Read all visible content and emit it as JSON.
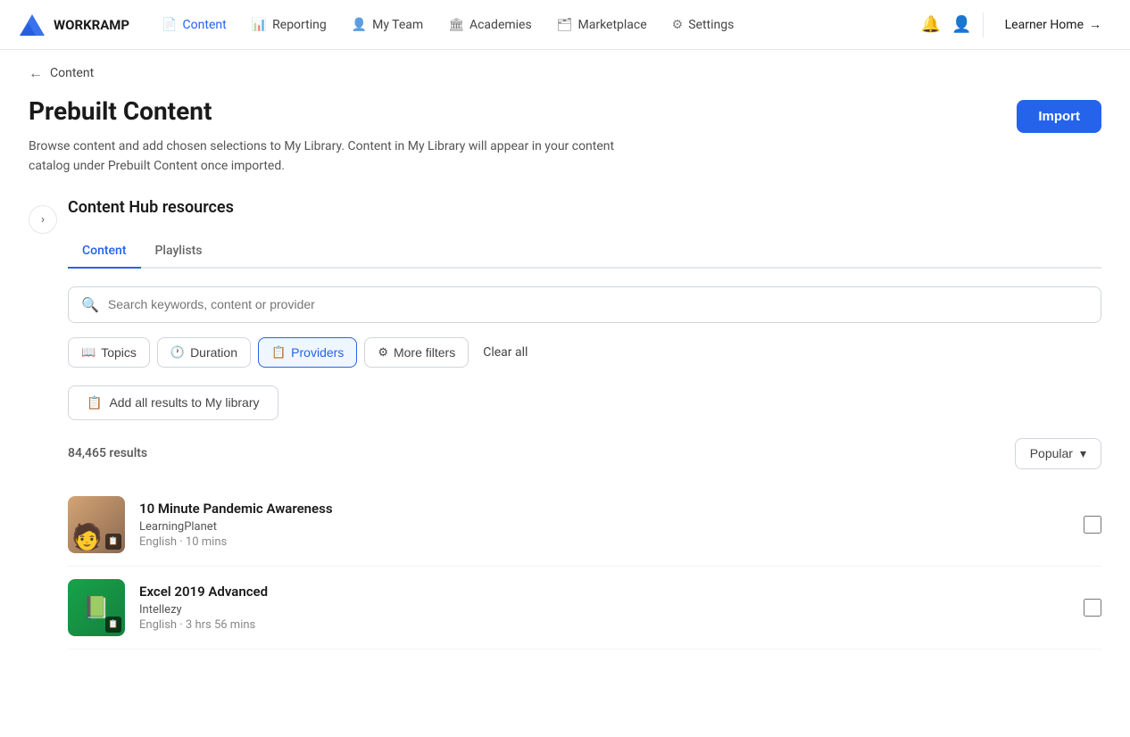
{
  "app": {
    "name": "WORKRAMP"
  },
  "nav": {
    "items": [
      {
        "id": "content",
        "label": "Content",
        "icon": "📄",
        "active": true
      },
      {
        "id": "reporting",
        "label": "Reporting",
        "icon": "📊"
      },
      {
        "id": "my-team",
        "label": "My Team",
        "icon": "👤"
      },
      {
        "id": "academies",
        "label": "Academies",
        "icon": "🏛"
      },
      {
        "id": "marketplace",
        "label": "Marketplace",
        "icon": "🗂"
      },
      {
        "id": "settings",
        "label": "Settings",
        "icon": "⚙"
      }
    ],
    "learner_home": "Learner Home"
  },
  "breadcrumb": {
    "back_label": "←",
    "link_label": "Content"
  },
  "page": {
    "title": "Prebuilt Content",
    "description": "Browse content and add chosen selections to My Library. Content in My Library will appear in your content catalog under Prebuilt Content once imported.",
    "import_button": "Import"
  },
  "content_hub": {
    "section_title": "Content Hub resources",
    "tabs": [
      {
        "id": "content",
        "label": "Content",
        "active": true
      },
      {
        "id": "playlists",
        "label": "Playlists",
        "active": false
      }
    ],
    "search": {
      "placeholder": "Search keywords, content or provider"
    },
    "filters": [
      {
        "id": "topics",
        "label": "Topics",
        "icon": "📖",
        "active": false
      },
      {
        "id": "duration",
        "label": "Duration",
        "icon": "🕐",
        "active": false
      },
      {
        "id": "providers",
        "label": "Providers",
        "icon": "📋",
        "active": true
      },
      {
        "id": "more-filters",
        "label": "More filters",
        "icon": "⚙",
        "active": false
      }
    ],
    "clear_all_label": "Clear all",
    "add_all_label": "Add all results to My library",
    "results_count": "84,465 results",
    "sort_label": "Popular",
    "items": [
      {
        "id": "pandemic-awareness",
        "title": "10 Minute Pandemic Awareness",
        "provider": "LearningPlanet",
        "language": "English",
        "duration": "10 mins",
        "thumb_type": "pandemic"
      },
      {
        "id": "excel-2019",
        "title": "Excel 2019 Advanced",
        "provider": "Intellezy",
        "language": "English",
        "duration": "3 hrs 56 mins",
        "thumb_type": "excel"
      }
    ]
  }
}
